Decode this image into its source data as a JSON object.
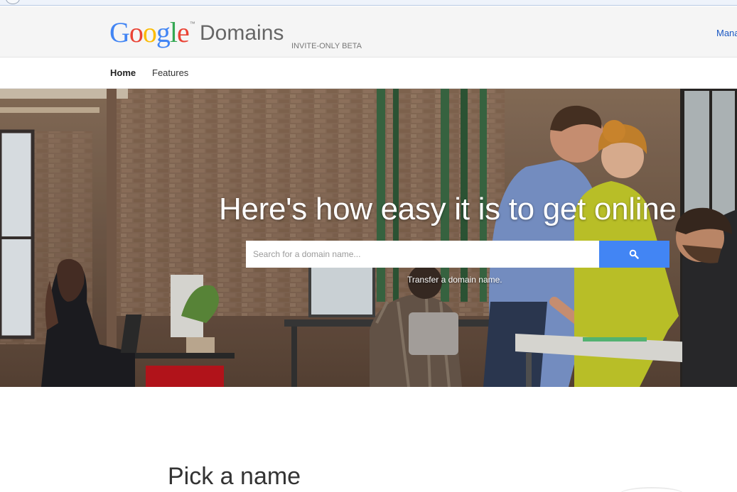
{
  "header": {
    "logo_google": "Google",
    "logo_tm": "™",
    "logo_product": "Domains",
    "beta_label": "INVITE-ONLY BETA",
    "manage_link": "Mana"
  },
  "nav": {
    "items": [
      {
        "label": "Home",
        "active": true
      },
      {
        "label": "Features",
        "active": false
      }
    ]
  },
  "hero": {
    "title": "Here's how easy it is to get online",
    "search_placeholder": "Search for a domain name...",
    "search_icon": "search-icon",
    "transfer_link": "Transfer a domain name."
  },
  "section": {
    "title": "Pick a name"
  },
  "colors": {
    "search_button": "#4285f4",
    "link": "#1a57c2",
    "google_blue": "#4285f4",
    "google_red": "#ea4335",
    "google_yellow": "#fbbc05",
    "google_green": "#34a853"
  }
}
